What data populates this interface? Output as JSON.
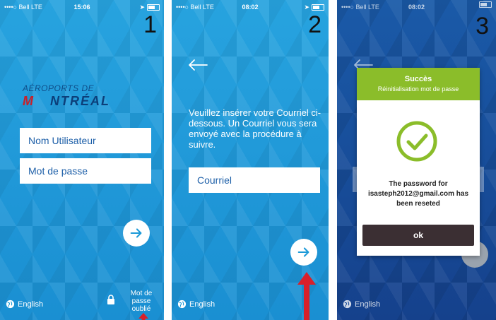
{
  "colors": {
    "screen_blue": "#1d9ad8",
    "success_green": "#8bbd2a",
    "ok_button": "#3b2f33",
    "arrow_red": "#d8202a",
    "logo_blue": "#0c3f7a",
    "logo_red": "#c8202a"
  },
  "screens": [
    {
      "status": {
        "carrier": "••••○ Bell  LTE",
        "time": "15:06"
      },
      "step": "1",
      "logo": {
        "top": "AÉROPORTS DE",
        "m": "M",
        "rest": "NTRÉAL"
      },
      "username_placeholder": "Nom Utilisateur",
      "password_placeholder": "Mot de passe",
      "next_icon": "arrow-right-icon",
      "language": "English",
      "lock_icon": "lock-icon",
      "forgot_password": [
        "Mot de",
        "passe",
        "oublié"
      ]
    },
    {
      "status": {
        "carrier": "••••○ Bell  LTE",
        "time": "08:02"
      },
      "step": "2",
      "instruction": "Veuillez insérer votre Courriel ci-dessous. Un Courriel vous sera envoyé avec la procédure à suivre.",
      "email_placeholder": "Courriel",
      "next_icon": "arrow-right-icon",
      "language": "English"
    },
    {
      "status": {
        "carrier": "••••○ Bell  LTE",
        "time": "08:02"
      },
      "step": "3",
      "dialog": {
        "title": "Succès",
        "subtitle": "Réinitialisation mot de passe",
        "message_line1": "The password for",
        "message_line2": "isasteph2012@gmail.com has",
        "message_line3": "been reseted",
        "ok": "ok"
      },
      "language": "English"
    }
  ]
}
